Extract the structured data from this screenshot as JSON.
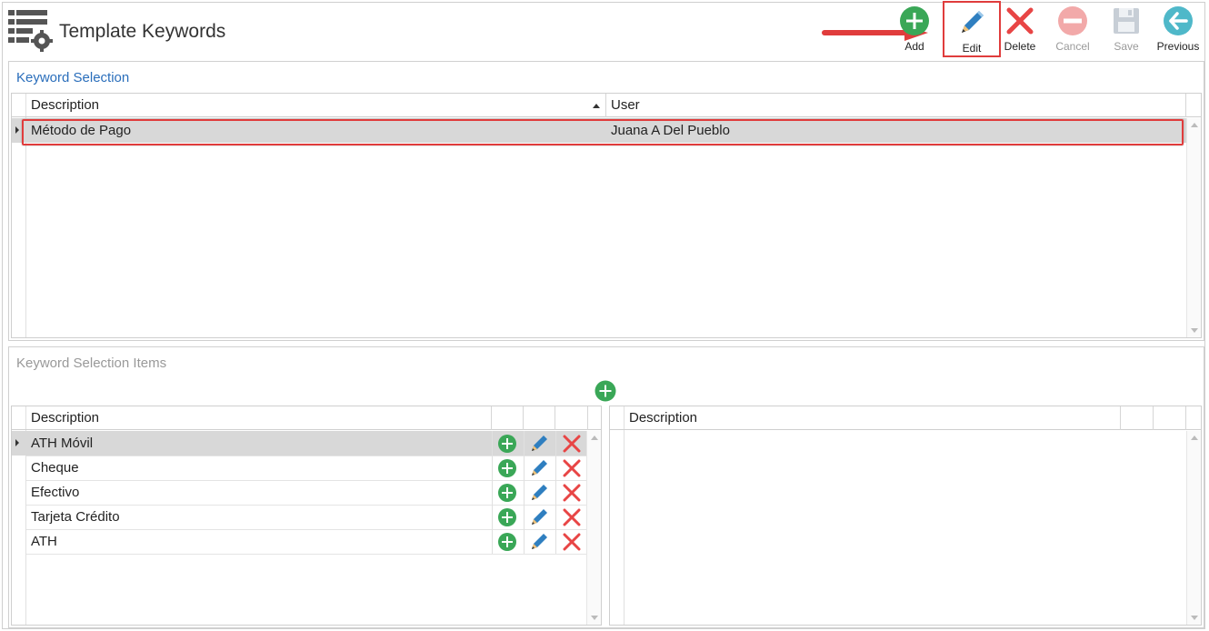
{
  "header": {
    "title": "Template Keywords",
    "app_icon": "grid-settings-icon"
  },
  "toolbar": {
    "add_label": "Add",
    "edit_label": "Edit",
    "delete_label": "Delete",
    "cancel_label": "Cancel",
    "save_label": "Save",
    "previous_label": "Previous"
  },
  "keyword_selection": {
    "title": "Keyword Selection",
    "columns": [
      "Description",
      "User"
    ],
    "rows": [
      {
        "description": "Método de Pago",
        "user": "Juana A Del Pueblo"
      }
    ]
  },
  "keyword_items": {
    "title": "Keyword Selection Items",
    "left_columns": [
      "Description"
    ],
    "rows": [
      {
        "description": "ATH Móvil"
      },
      {
        "description": "Cheque"
      },
      {
        "description": "Efectivo"
      },
      {
        "description": "Tarjeta Crédito"
      },
      {
        "description": "ATH"
      }
    ],
    "right_columns": [
      "Description"
    ]
  },
  "colors": {
    "accent_blue": "#2a6ebb",
    "highlight_red": "#e03c3c",
    "add_green": "#3aa757",
    "edit_blue": "#2f7fc0"
  }
}
